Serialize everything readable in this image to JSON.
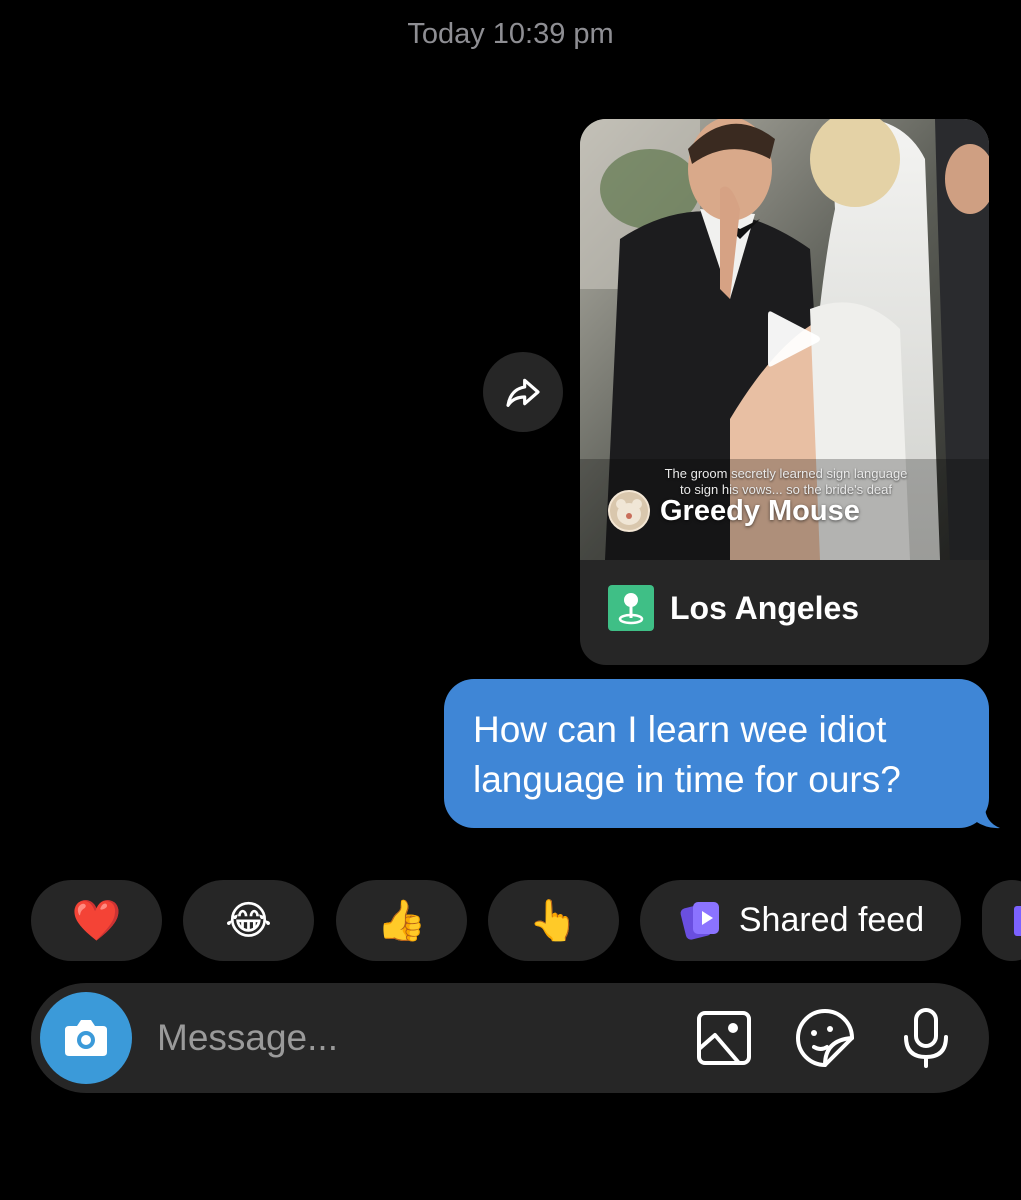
{
  "conversation": {
    "timestamp": "Today 10:39 pm"
  },
  "shared_post": {
    "caption_lines": [
      "The groom secretly learned sign language",
      "to sign his vows... so the bride's deaf"
    ],
    "author_name": "Greedy Mouse",
    "location": "Los Angeles",
    "icons": {
      "play": "play-icon",
      "share": "share-arrow-icon",
      "location": "location-pin-icon"
    }
  },
  "outgoing_message": {
    "text": "How can I learn wee idiot language in time for ours?",
    "color": "#3f86d6"
  },
  "quick_reactions": [
    {
      "emoji": "❤️",
      "icon": "red-heart-icon"
    },
    {
      "emoji": "😂",
      "icon": "tears-of-joy-icon"
    },
    {
      "emoji": "👍",
      "icon": "thumbs-up-icon"
    },
    {
      "emoji": "👆",
      "icon": "pointing-hand-icon"
    },
    {
      "label": "Shared feed",
      "icon": "shared-feed-icon"
    }
  ],
  "composer": {
    "placeholder": "Message...",
    "icons": [
      "camera-icon",
      "gallery-icon",
      "sticker-icon",
      "microphone-icon"
    ]
  },
  "colors": {
    "background": "#000000",
    "surface": "#262626",
    "accent_blue": "#3f86d6",
    "camera_blue": "#3b9ad9",
    "location_green": "#3fbf86",
    "shared_feed_purple": "#7b61ff"
  }
}
